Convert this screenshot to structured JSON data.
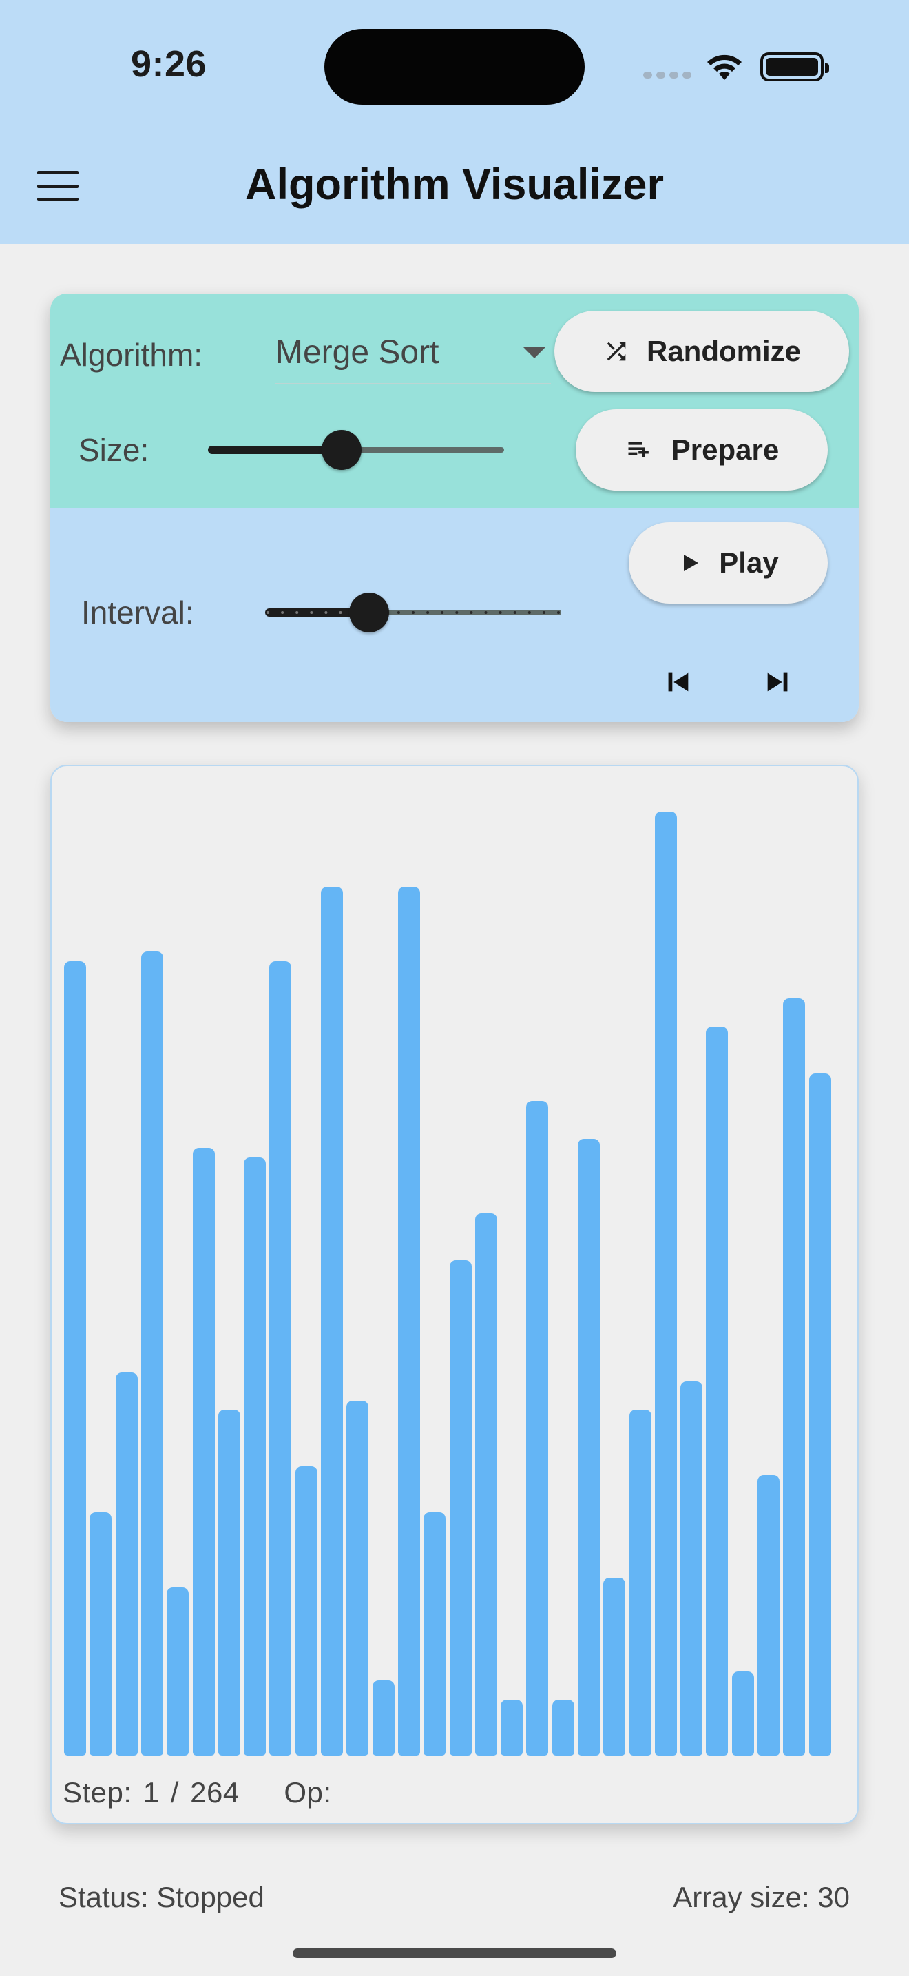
{
  "status_bar": {
    "time": "9:26"
  },
  "appbar": {
    "title": "Algorithm Visualizer",
    "menu_icon": "menu-icon"
  },
  "controls": {
    "algorithm_label": "Algorithm:",
    "algorithm_value": "Merge Sort",
    "randomize_label": "Randomize",
    "size_label": "Size:",
    "size_slider_fraction": 0.45,
    "prepare_label": "Prepare",
    "interval_label": "Interval:",
    "interval_slider_fraction": 0.35,
    "play_label": "Play",
    "step_back_icon": "skip-previous-icon",
    "step_forward_icon": "skip-next-icon"
  },
  "visualizer": {
    "values": [
      85,
      26,
      41,
      86,
      18,
      65,
      37,
      64,
      85,
      31,
      93,
      38,
      8,
      93,
      26,
      53,
      58,
      6,
      70,
      6,
      66,
      19,
      37,
      101,
      40,
      78,
      9,
      30,
      81,
      73
    ],
    "value_max": 101,
    "bar_color": "#64b5f5",
    "step_text": "Step: 1 / 264",
    "op_text": "Op:"
  },
  "footer": {
    "status_text": "Status: Stopped",
    "array_size_text": "Array size: 30"
  },
  "colors": {
    "appbar": "#bcdcf7",
    "controls_top": "#98e1da",
    "controls_bottom": "#bcdcf7",
    "background": "#efefef"
  }
}
